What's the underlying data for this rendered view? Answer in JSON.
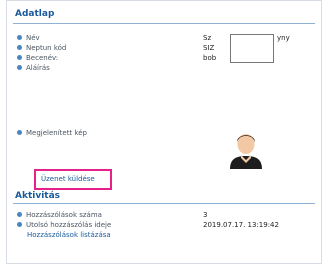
{
  "datasheet": {
    "title": "Adatlap",
    "rows": [
      {
        "label": "Név",
        "value": "Sz",
        "value_tail": "yny"
      },
      {
        "label": "Neptun kód",
        "value": "SIZ"
      },
      {
        "label": "Becenév:",
        "value": "bob"
      },
      {
        "label": "Aláírás",
        "value": ""
      }
    ],
    "image_label": "Megjelenített kép",
    "avatar_icon": "user-avatar-icon",
    "send_message": "Üzenet küldése"
  },
  "activity": {
    "title": "Aktivitás",
    "rows": [
      {
        "label": "Hozzászólások száma",
        "value": "3"
      },
      {
        "label": "Utolsó hozzászólás ideje",
        "value": "2019.07.17. 13:19:42"
      }
    ],
    "list_link": "Hozzászólások listázása"
  },
  "colors": {
    "accent": "#1a5a9a",
    "highlight": "#e8208a",
    "bullet": "#4a86c0"
  }
}
